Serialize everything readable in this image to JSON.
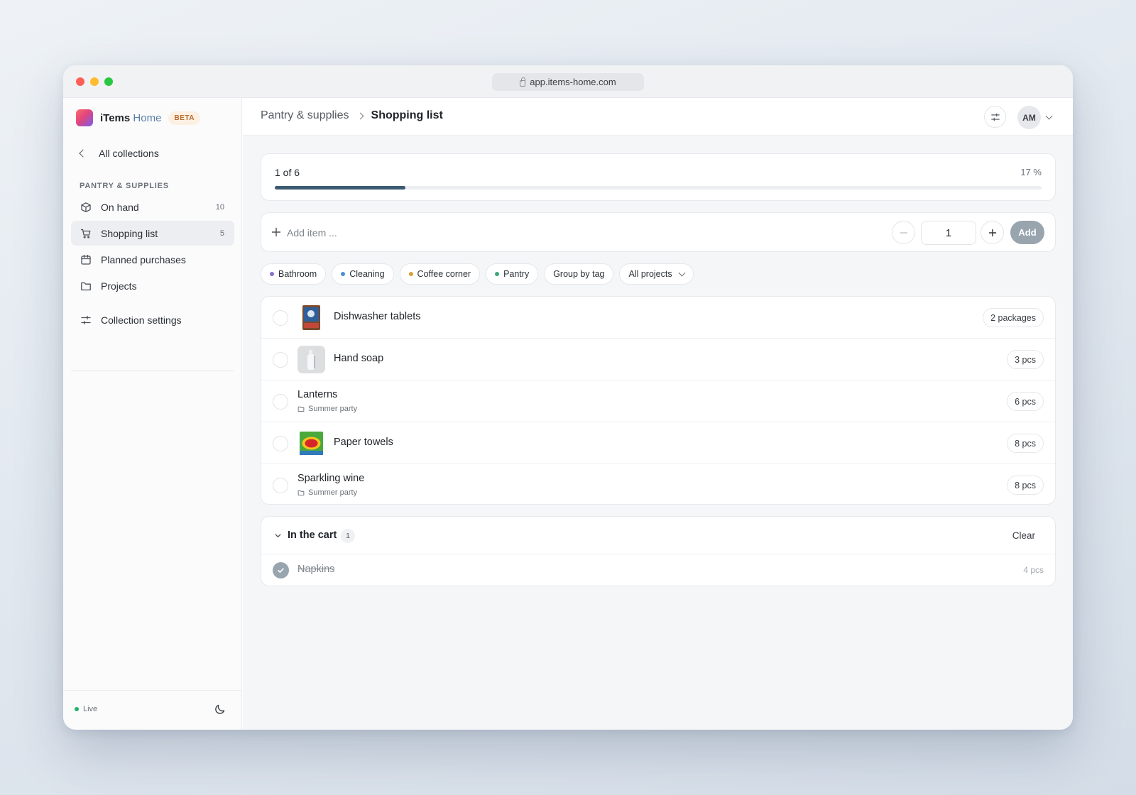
{
  "browser": {
    "url": "app.items-home.com"
  },
  "sidebar": {
    "brand_name": "iTems",
    "brand_home": "Home",
    "badge": "BETA",
    "back_label": "All collections",
    "section": "PANTRY & SUPPLIES",
    "items": [
      {
        "label": "On hand",
        "count": "10",
        "icon": "box-icon"
      },
      {
        "label": "Shopping list",
        "count": "5",
        "icon": "cart-icon",
        "active": true
      },
      {
        "label": "Planned purchases",
        "count": "",
        "icon": "calendar-icon"
      },
      {
        "label": "Projects",
        "count": "",
        "icon": "folder-icon"
      }
    ],
    "settings_label": "Collection settings",
    "status": "Live",
    "theme_icon": "moon-icon"
  },
  "header": {
    "breadcrumb_parent": "Pantry & supplies",
    "breadcrumb_current": "Shopping list",
    "avatar_initials": "AM"
  },
  "progress": {
    "label": "1 of 6",
    "percent_label": "17 %",
    "fraction": 0.17
  },
  "add_item": {
    "placeholder": "Add item ...",
    "quantity": "1",
    "add_label": "Add"
  },
  "filters": [
    {
      "label": "Bathroom",
      "color": "#8a6fd1"
    },
    {
      "label": "Cleaning",
      "color": "#4a8fd6"
    },
    {
      "label": "Coffee corner",
      "color": "#d6a13a"
    },
    {
      "label": "Pantry",
      "color": "#3aa876"
    }
  ],
  "group_by_label": "Group by tag",
  "projects_filter_label": "All projects",
  "items": [
    {
      "name": "Dishwasher tablets",
      "qty": "2 packages",
      "project": ""
    },
    {
      "name": "Hand soap",
      "qty": "3 pcs",
      "project": ""
    },
    {
      "name": "Lanterns",
      "qty": "6 pcs",
      "project": "Summer party"
    },
    {
      "name": "Paper towels",
      "qty": "8 pcs",
      "project": ""
    },
    {
      "name": "Sparkling wine",
      "qty": "8 pcs",
      "project": "Summer party"
    }
  ],
  "cart": {
    "title": "In the cart",
    "count": "1",
    "clear_label": "Clear",
    "items": [
      {
        "name": "Napkins",
        "qty": "4 pcs"
      }
    ]
  },
  "colors": {
    "accent": "#3c5a72",
    "live": "#20b26b",
    "beta": "#b8692c"
  }
}
